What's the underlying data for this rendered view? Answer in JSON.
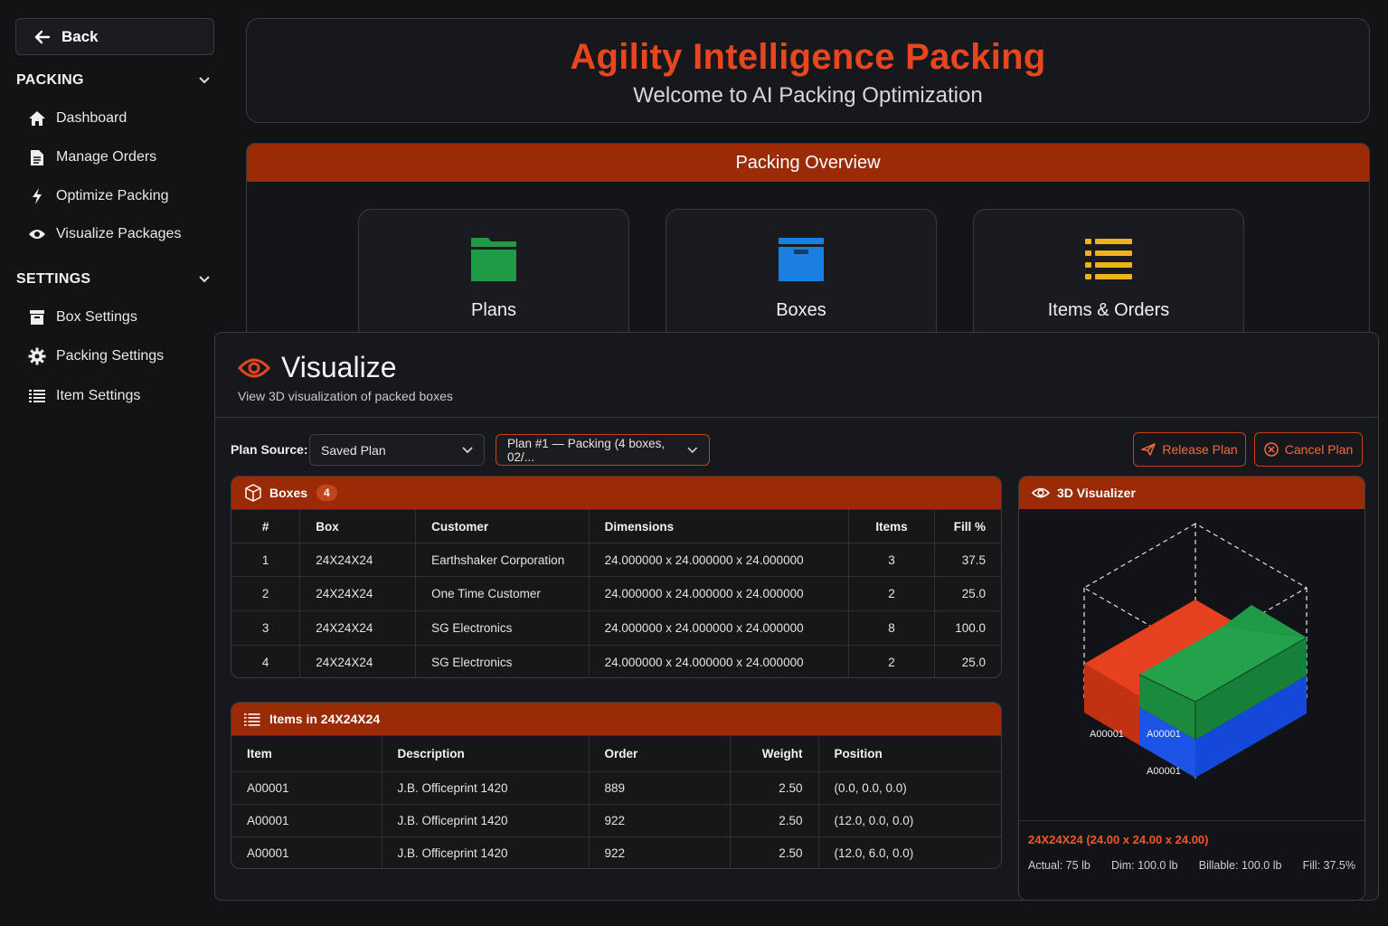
{
  "sidebar": {
    "back_label": "Back",
    "packing_section": "PACKING",
    "packing_items": [
      {
        "label": "Dashboard",
        "icon": "home-icon"
      },
      {
        "label": "Manage Orders",
        "icon": "document-icon"
      },
      {
        "label": "Optimize Packing",
        "icon": "bolt-icon"
      },
      {
        "label": "Visualize Packages",
        "icon": "eye-icon"
      }
    ],
    "settings_section": "SETTINGS",
    "settings_items": [
      {
        "label": "Box Settings",
        "icon": "box-icon"
      },
      {
        "label": "Packing Settings",
        "icon": "gear-icon"
      },
      {
        "label": "Item Settings",
        "icon": "list-icon"
      }
    ]
  },
  "header": {
    "title": "Agility Intelligence Packing",
    "subtitle": "Welcome to AI Packing Optimization"
  },
  "overview": {
    "title": "Packing Overview",
    "cards": [
      {
        "label": "Plans",
        "icon": "folder-icon",
        "color": "#1f9a46"
      },
      {
        "label": "Boxes",
        "icon": "archive-box-icon",
        "color": "#1b7fe0"
      },
      {
        "label": "Items & Orders",
        "icon": "list-icon",
        "color": "#f0b21a"
      }
    ]
  },
  "visualize": {
    "title": "Visualize",
    "subtitle": "View 3D visualization of packed boxes",
    "plan_source_label": "Plan Source:",
    "plan_source_value": "Saved Plan",
    "plan_value": "Plan #1 — Packing (4 boxes, 02/...",
    "release_label": "Release Plan",
    "cancel_label": "Cancel Plan",
    "boxes_title": "Boxes",
    "boxes_count": "4",
    "boxes_columns": [
      "#",
      "Box",
      "Customer",
      "Dimensions",
      "Items",
      "Fill %"
    ],
    "boxes_rows": [
      [
        "1",
        "24X24X24",
        "Earthshaker Corporation",
        "24.000000 x 24.000000 x 24.000000",
        "3",
        "37.5"
      ],
      [
        "2",
        "24X24X24",
        "One Time Customer",
        "24.000000 x 24.000000 x 24.000000",
        "2",
        "25.0"
      ],
      [
        "3",
        "24X24X24",
        "SG Electronics",
        "24.000000 x 24.000000 x 24.000000",
        "8",
        "100.0"
      ],
      [
        "4",
        "24X24X24",
        "SG Electronics",
        "24.000000 x 24.000000 x 24.000000",
        "2",
        "25.0"
      ]
    ],
    "items_title": "Items in 24X24X24",
    "items_columns": [
      "Item",
      "Description",
      "Order",
      "Weight",
      "Position"
    ],
    "items_rows": [
      [
        "A00001",
        "J.B. Officeprint 1420",
        "889",
        "2.50",
        "(0.0, 0.0, 0.0)"
      ],
      [
        "A00001",
        "J.B. Officeprint 1420",
        "922",
        "2.50",
        "(12.0, 0.0, 0.0)"
      ],
      [
        "A00001",
        "J.B. Officeprint 1420",
        "922",
        "2.50",
        "(12.0, 6.0, 0.0)"
      ]
    ],
    "visualizer_title": "3D Visualizer",
    "viz_labels": [
      "A00001",
      "A00001",
      "A00001"
    ],
    "viz_colors": {
      "red": "#e5401f",
      "green": "#1f9a46",
      "blue": "#1448d8"
    },
    "box_dim": "24X24X24 (24.00 x 24.00 x 24.00)",
    "stats": [
      "Actual: 75 lb",
      "Dim: 100.0 lb",
      "Billable: 100.0 lb",
      "Fill: 37.5%"
    ]
  },
  "colors": {
    "accent": "#e8461e",
    "header_bar": "#9b2a07",
    "background": "#121315"
  }
}
